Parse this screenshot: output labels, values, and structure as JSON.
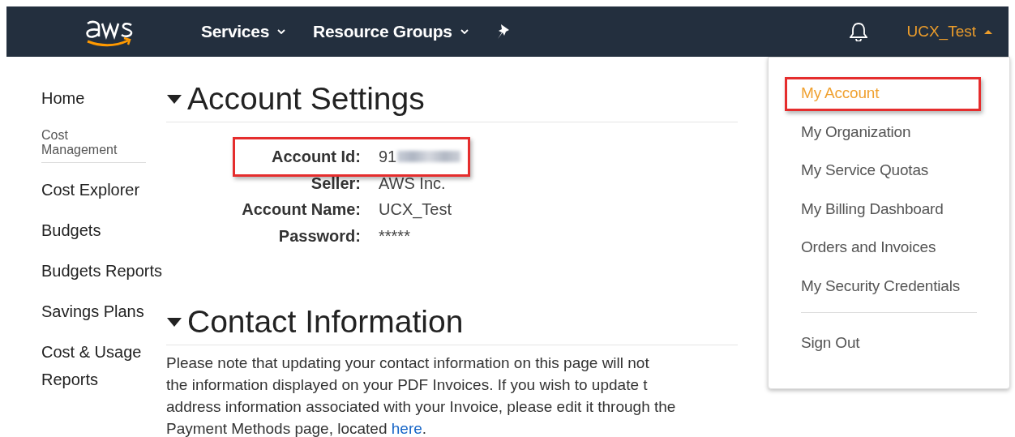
{
  "navbar": {
    "menus": [
      {
        "label": "Services",
        "dropdown": true
      },
      {
        "label": "Resource Groups",
        "dropdown": true
      }
    ],
    "user": {
      "label": "UCX_Test",
      "expanded": true
    }
  },
  "sidebar": {
    "items": [
      {
        "kind": "link",
        "label": "Home"
      },
      {
        "kind": "heading",
        "label": "Cost Management"
      },
      {
        "kind": "link",
        "label": "Cost Explorer"
      },
      {
        "kind": "link",
        "label": "Budgets"
      },
      {
        "kind": "link",
        "label": "Budgets Reports"
      },
      {
        "kind": "link",
        "label": "Savings Plans"
      },
      {
        "kind": "link",
        "label": "Cost & Usage Reports"
      }
    ]
  },
  "account_settings": {
    "title": "Account Settings",
    "expanded": true,
    "fields": [
      {
        "label": "Account Id:",
        "value": "91",
        "redacted": true,
        "highlighted": true
      },
      {
        "label": "Seller:",
        "value": "AWS Inc.",
        "redacted": false,
        "highlighted": false
      },
      {
        "label": "Account Name:",
        "value": "UCX_Test",
        "redacted": false,
        "highlighted": false
      },
      {
        "label": "Password:",
        "value": "*****",
        "redacted": false,
        "highlighted": false
      }
    ]
  },
  "contact_information": {
    "title": "Contact Information",
    "expanded": true,
    "lines": [
      "Please note that updating your contact information on this page will not",
      "the information displayed on your PDF Invoices. If you wish to update t",
      "address information associated with your Invoice, please edit it through the",
      "Payment Methods page, located "
    ],
    "link": "here",
    "after_link": "."
  },
  "user_menu": {
    "items": [
      {
        "label": "My Account",
        "selected": true,
        "highlighted": true
      },
      {
        "label": "My Organization",
        "selected": false,
        "highlighted": false
      },
      {
        "label": "My Service Quotas",
        "selected": false,
        "highlighted": false
      },
      {
        "label": "My Billing Dashboard",
        "selected": false,
        "highlighted": false
      },
      {
        "label": "Orders and Invoices",
        "selected": false,
        "highlighted": false
      },
      {
        "label": "My Security Credentials",
        "selected": false,
        "highlighted": false
      }
    ],
    "footer_item": "Sign Out"
  }
}
